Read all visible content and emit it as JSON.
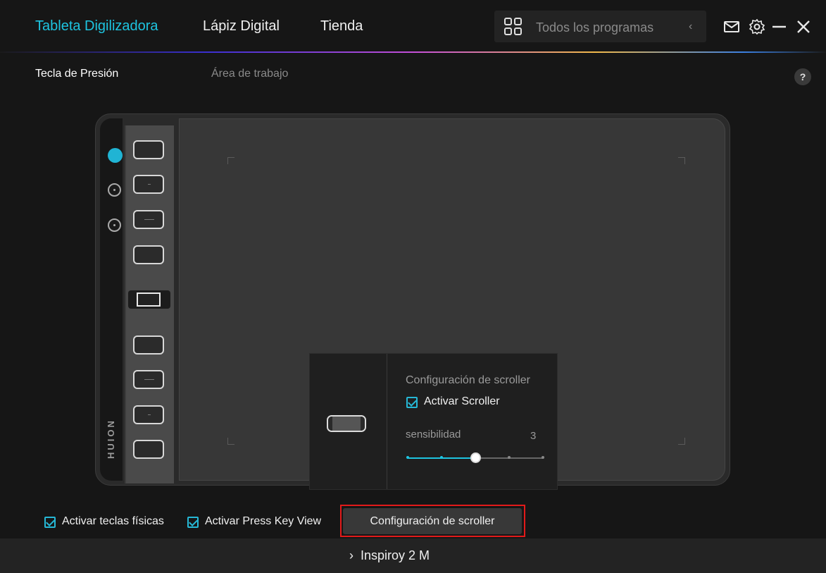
{
  "header": {
    "tabs": [
      {
        "label": "Tableta Digilizadora",
        "active": true
      },
      {
        "label": "Lápiz Digital",
        "active": false
      },
      {
        "label": "Tienda",
        "active": false
      }
    ],
    "programs_placeholder": "Todos los programas",
    "icons": [
      "grid-icon",
      "chevron-left-icon",
      "mail-icon",
      "gear-icon",
      "minimize-icon",
      "close-icon"
    ]
  },
  "subtabs": [
    {
      "label": "Tecla de Presión",
      "active": true
    },
    {
      "label": "Área de trabajo",
      "active": false
    }
  ],
  "help_label": "?",
  "tablet": {
    "brand": "HUION"
  },
  "scroller_popup": {
    "title": "Configuración de scroller",
    "enable_label": "Activar Scroller",
    "enable_checked": true,
    "sensitivity_label": "sensibilidad",
    "sensitivity_value": "3",
    "sensitivity_level": 3,
    "sensitivity_max": 5
  },
  "options": {
    "physical_keys_label": "Activar teclas físicas",
    "physical_keys_checked": true,
    "press_key_view_label": "Activar Press Key View",
    "press_key_view_checked": true,
    "scroller_button_label": "Configuración de scroller"
  },
  "footer": {
    "device_name": "Inspiroy 2 M"
  },
  "colors": {
    "accent": "#1ec4e0",
    "highlight": "#e21a1a",
    "background": "#161616"
  }
}
